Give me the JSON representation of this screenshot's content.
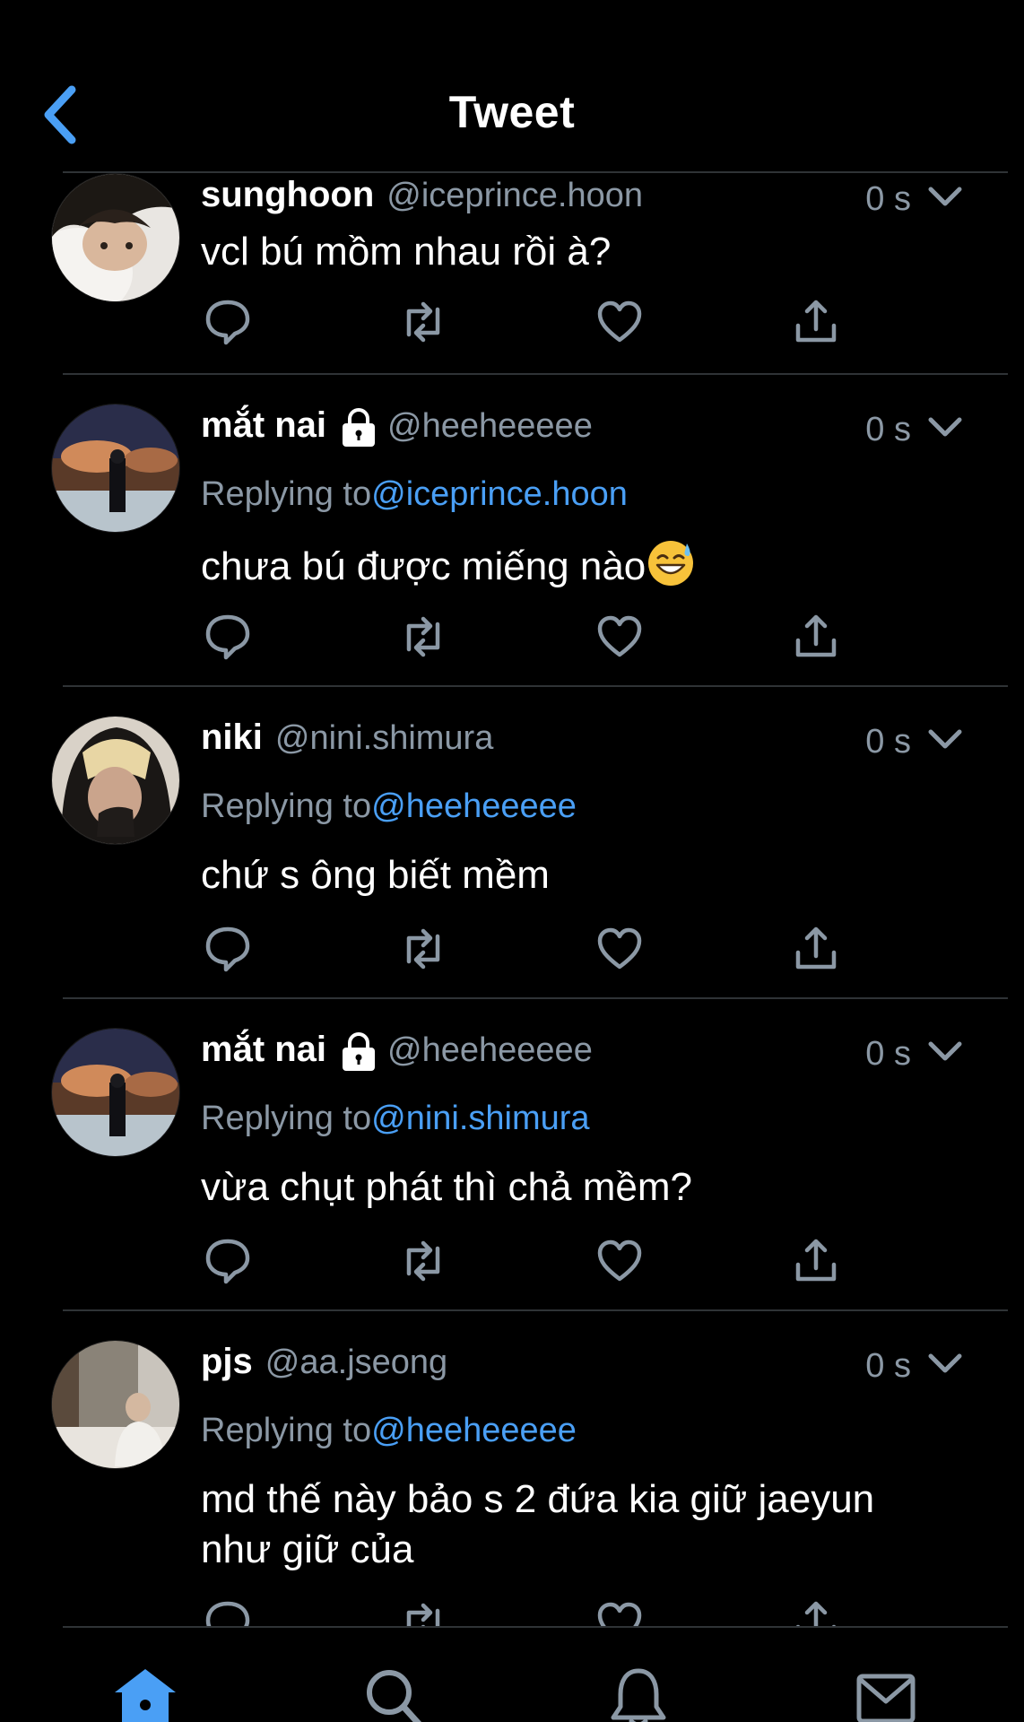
{
  "header": {
    "title": "Tweet"
  },
  "colors": {
    "background": "#000000",
    "text": "#ffffff",
    "muted": "#8b98a5",
    "link": "#4a9ff5",
    "divider": "#2f3336",
    "icon": "#8b98a5"
  },
  "tweets": [
    {
      "display_name": "sunghoon",
      "handle": "@iceprince.hoon",
      "locked": false,
      "time": "0 s",
      "reply_prefix": "",
      "reply_to": "",
      "text": "vcl bú mồm nhau rồi à?",
      "text_line2": "",
      "emoji": ""
    },
    {
      "display_name": "mắt nai",
      "handle": "@heeheeeee",
      "locked": true,
      "time": "0 s",
      "reply_prefix": "Replying to",
      "reply_to": "@iceprince.hoon",
      "text": "chưa bú được miếng nào",
      "text_line2": "",
      "emoji": "sweat-smile-emoji"
    },
    {
      "display_name": "niki",
      "handle": "@nini.shimura",
      "locked": false,
      "time": "0 s",
      "reply_prefix": "Replying to",
      "reply_to": "@heeheeeee",
      "text": "chứ s ông biết mềm",
      "text_line2": "",
      "emoji": ""
    },
    {
      "display_name": "mắt nai",
      "handle": "@heeheeeee",
      "locked": true,
      "time": "0 s",
      "reply_prefix": "Replying to",
      "reply_to": "@nini.shimura",
      "text": "vừa chụt phát thì chả mềm?",
      "text_line2": "",
      "emoji": ""
    },
    {
      "display_name": "pjs",
      "handle": "@aa.jseong",
      "locked": false,
      "time": "0 s",
      "reply_prefix": "Replying to",
      "reply_to": "@heeheeeee",
      "text": "md thế này bảo s 2 đứa kia giữ jaeyun",
      "text_line2": "như giữ của",
      "emoji": ""
    }
  ],
  "icons": {
    "back": "chevron-left-icon",
    "more": "chevron-down-icon",
    "lock": "lock-icon",
    "reply": "reply-bubble-icon",
    "retweet": "retweet-icon",
    "like": "heart-icon",
    "share": "share-icon",
    "home": "home-icon",
    "search": "search-icon",
    "notifications": "bell-icon",
    "messages": "mail-icon"
  },
  "tabbar": {
    "active": "home"
  }
}
